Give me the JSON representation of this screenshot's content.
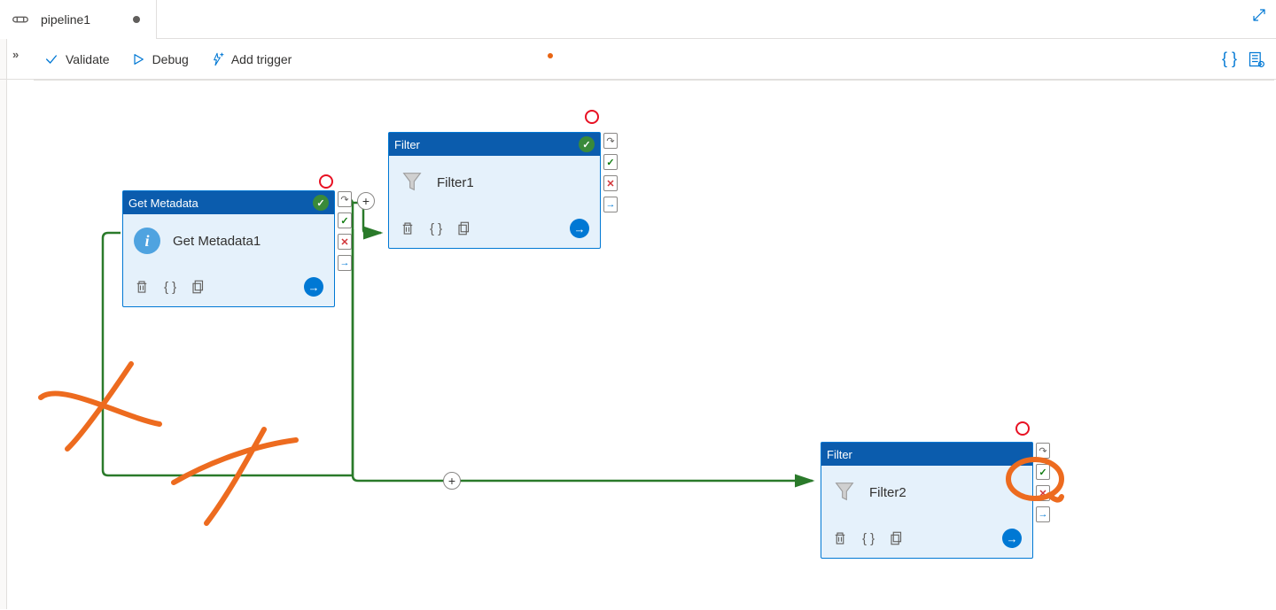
{
  "tab": {
    "title": "pipeline1"
  },
  "toolbar": {
    "validate": "Validate",
    "debug": "Debug",
    "add_trigger": "Add trigger"
  },
  "nodes": {
    "getmeta": {
      "header": "Get Metadata",
      "label": "Get Metadata1"
    },
    "filter1": {
      "header": "Filter",
      "label": "Filter1"
    },
    "filter2": {
      "header": "Filter",
      "label": "Filter2"
    }
  }
}
